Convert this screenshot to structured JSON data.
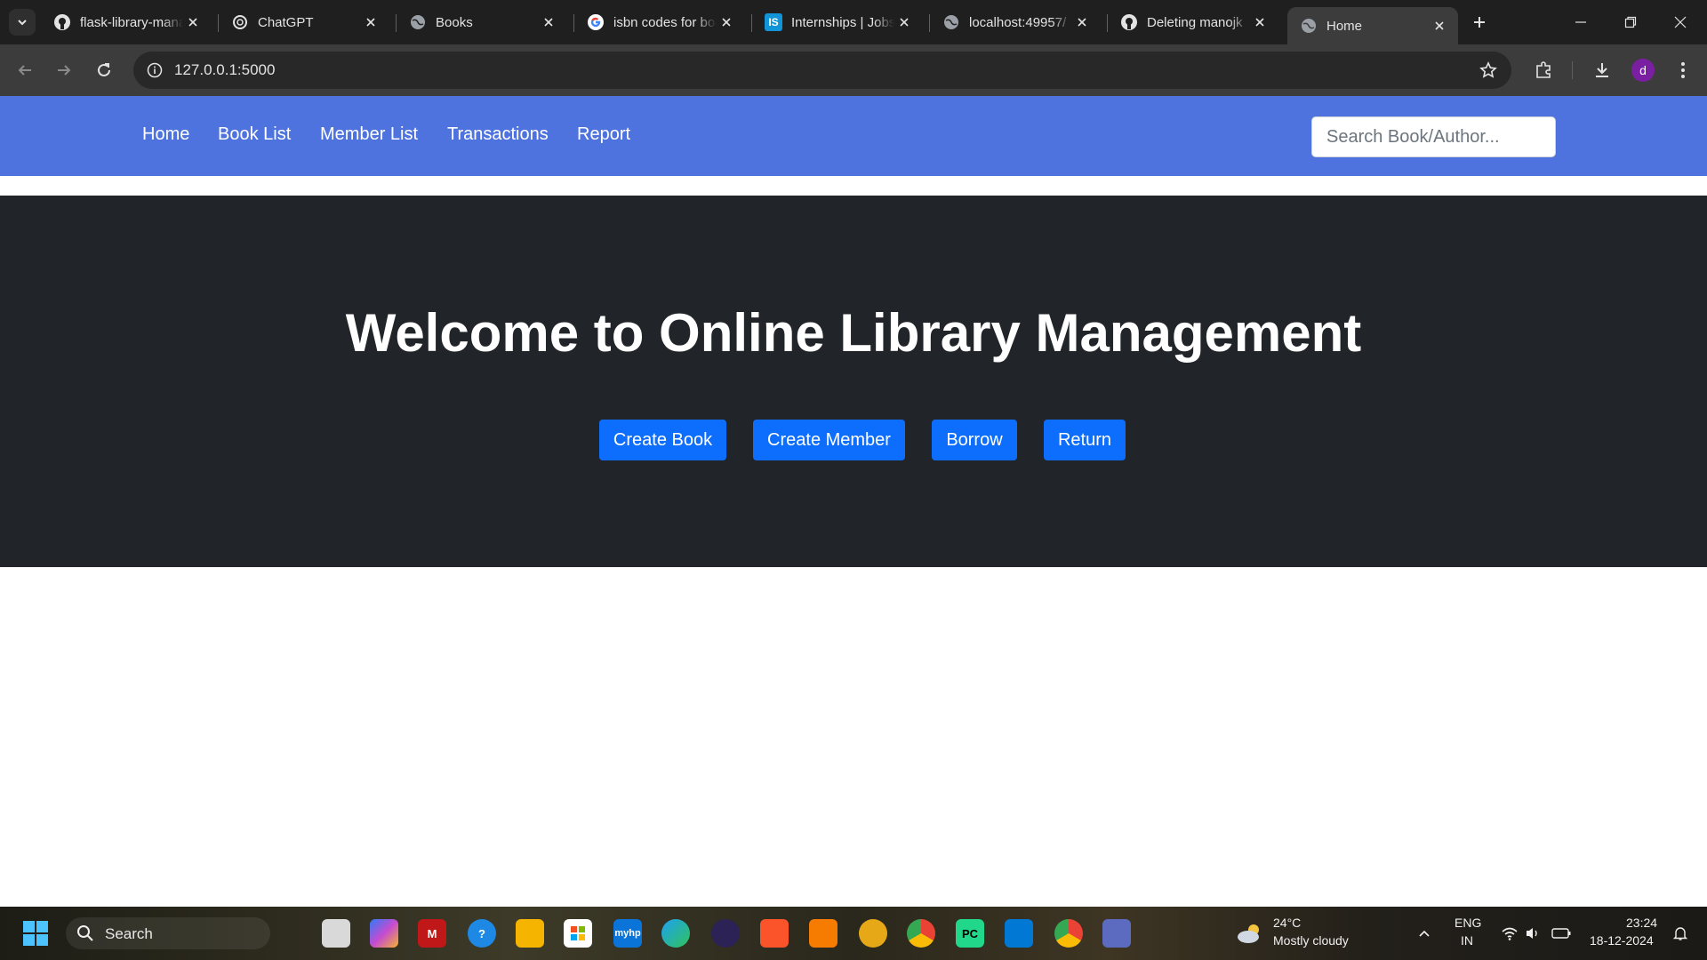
{
  "browser": {
    "tabs": [
      {
        "title": "flask-library-management",
        "favicon": "github-icon",
        "active": false
      },
      {
        "title": "ChatGPT",
        "favicon": "chatgpt-icon",
        "active": false
      },
      {
        "title": "Books",
        "favicon": "globe-icon",
        "active": false
      },
      {
        "title": "isbn codes for books",
        "favicon": "google-icon",
        "active": false
      },
      {
        "title": "Internships | Jobs",
        "favicon": "internshala-icon",
        "active": false
      },
      {
        "title": "localhost:49957/",
        "favicon": "globe-icon",
        "active": false
      },
      {
        "title": "Deleting manojk",
        "favicon": "github-icon",
        "active": false
      },
      {
        "title": "Home",
        "favicon": "globe-icon",
        "active": true
      }
    ],
    "url": "127.0.0.1:5000",
    "profile_initial": "d"
  },
  "navbar": {
    "links": [
      "Home",
      "Book List",
      "Member List",
      "Transactions",
      "Report"
    ],
    "search_placeholder": "Search Book/Author..."
  },
  "hero": {
    "title": "Welcome to Online Library Management",
    "buttons": [
      "Create Book",
      "Create Member",
      "Borrow",
      "Return"
    ]
  },
  "taskbar": {
    "search_label": "Search",
    "weather_temp": "24°C",
    "weather_desc": "Mostly cloudy",
    "lang_line1": "ENG",
    "lang_line2": "IN",
    "time": "23:24",
    "date": "18-12-2024"
  },
  "colors": {
    "navbar_bg": "#4e73df",
    "hero_bg": "#212529",
    "button_primary": "#0d6efd",
    "chrome_tabstrip": "#1f1f1f",
    "chrome_toolbar": "#3c3c3c"
  }
}
